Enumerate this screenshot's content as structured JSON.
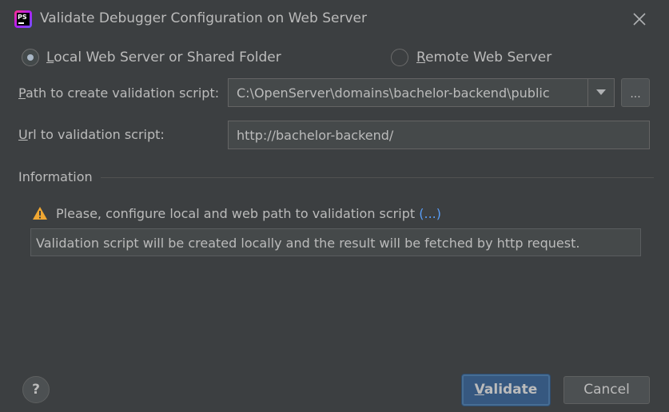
{
  "window": {
    "title": "Validate Debugger Configuration on Web Server",
    "app_icon_text": "PS"
  },
  "mode": {
    "local_label": "Local Web Server or Shared Folder",
    "local_mnemonic": "L",
    "local_rest": "ocal Web Server or Shared Folder",
    "remote_label": "Remote Web Server",
    "remote_mnemonic": "R",
    "remote_rest": "emote Web Server",
    "selected": "local"
  },
  "path_field": {
    "label": "Path to create validation script:",
    "label_mnemonic": "P",
    "label_rest": "ath to create validation script:",
    "value": "C:\\OpenServer\\domains\\bachelor-backend\\public",
    "browse_label": "..."
  },
  "url_field": {
    "label": "Url to validation script:",
    "label_mnemonic": "U",
    "label_rest": "rl to validation script:",
    "value": "http://bachelor-backend/"
  },
  "information": {
    "section_title": "Information",
    "warning_text": "Please, configure local and web path to validation script",
    "more_link": "(...)",
    "details": "Validation script will be created locally and the result will be fetched by http request."
  },
  "footer": {
    "help_label": "?",
    "validate_label": "Validate",
    "validate_mnemonic": "V",
    "validate_rest": "alidate",
    "cancel_label": "Cancel"
  },
  "colors": {
    "background": "#3c3f41",
    "text": "#bbbbbb",
    "link": "#589df6",
    "warning": "#f0a732",
    "default_button": "#365880"
  }
}
